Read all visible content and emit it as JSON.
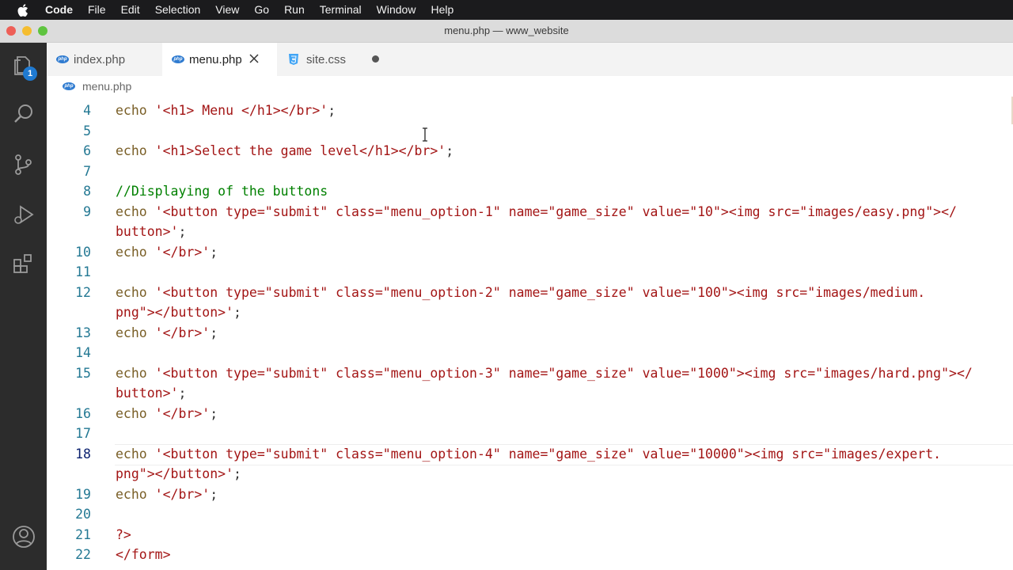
{
  "menubar": {
    "app": "Code",
    "items": [
      "File",
      "Edit",
      "Selection",
      "View",
      "Go",
      "Run",
      "Terminal",
      "Window",
      "Help"
    ]
  },
  "window": {
    "title": "menu.php — www_website"
  },
  "activity_bar": {
    "explorer_badge": "1"
  },
  "tabs": [
    {
      "label": "index.php",
      "icon": "php-icon"
    },
    {
      "label": "menu.php",
      "icon": "php-icon",
      "active": true
    },
    {
      "label": "site.css",
      "icon": "css-icon",
      "modified": true
    }
  ],
  "breadcrumb": {
    "file": "menu.php"
  },
  "editor": {
    "lines": [
      {
        "no": "4",
        "text": "echo '<h1> Menu </h1></br>';"
      },
      {
        "no": "5",
        "text": ""
      },
      {
        "no": "6",
        "text": "echo '<h1>Select the game level</h1></br>';"
      },
      {
        "no": "7",
        "text": ""
      },
      {
        "no": "8",
        "text": "//Displaying of the buttons"
      },
      {
        "no": "9",
        "text": "echo '<button type=\"submit\" class=\"menu_option-1\" name=\"game_size\" value=\"10\"><img src=\"images/easy.png\"></",
        "cont": "button>';"
      },
      {
        "no": "10",
        "text": "echo '</br>';"
      },
      {
        "no": "11",
        "text": ""
      },
      {
        "no": "12",
        "text": "echo '<button type=\"submit\" class=\"menu_option-2\" name=\"game_size\" value=\"100\"><img src=\"images/medium.",
        "cont": "png\"></button>';"
      },
      {
        "no": "13",
        "text": "echo '</br>';"
      },
      {
        "no": "14",
        "text": ""
      },
      {
        "no": "15",
        "text": "echo '<button type=\"submit\" class=\"menu_option-3\" name=\"game_size\" value=\"1000\"><img src=\"images/hard.png\"></",
        "cont": "button>';"
      },
      {
        "no": "16",
        "text": "echo '</br>';"
      },
      {
        "no": "17",
        "text": ""
      },
      {
        "no": "18",
        "text": "echo '<button type=\"submit\" class=\"menu_option-4\" name=\"game_size\" value=\"10000\"><img src=\"images/expert.",
        "cont": "png\"></button>';",
        "current": true
      },
      {
        "no": "19",
        "text": "echo '</br>';"
      },
      {
        "no": "20",
        "text": ""
      },
      {
        "no": "21",
        "text": "?>"
      },
      {
        "no": "22",
        "text": "</form>"
      }
    ]
  },
  "colors": {
    "line_number": "#237893",
    "string": "#a31515",
    "keyword": "#795e26",
    "comment": "#008000",
    "activity_bar": "#2c2c2c"
  }
}
